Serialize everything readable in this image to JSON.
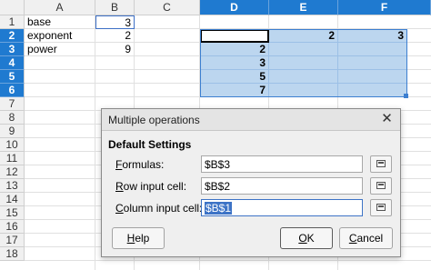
{
  "columns": [
    "A",
    "B",
    "C",
    "D",
    "E",
    "F"
  ],
  "rows": [
    "1",
    "2",
    "3",
    "4",
    "5",
    "6",
    "7",
    "8",
    "9",
    "10",
    "11",
    "12",
    "13",
    "14",
    "15",
    "16",
    "17",
    "18"
  ],
  "cells": {
    "a1": "base",
    "b1": "3",
    "a2": "exponent",
    "b2": "2",
    "a3": "power",
    "b3": "9",
    "e2": "2",
    "f2": "3",
    "d3": "2",
    "d4": "3",
    "d5": "5",
    "d6": "7"
  },
  "colors": {
    "selection_header": "#1f7ad0",
    "selection_fill": "#bcd6ef"
  },
  "dialog": {
    "title": "Multiple operations",
    "close_icon": "close-icon",
    "section": "Default Settings",
    "formulas_label_access": "F",
    "formulas_label_rest": "ormulas:",
    "formulas_value": "$B$3",
    "row_label_access": "R",
    "row_label_rest": "ow input cell:",
    "row_value": "$B$2",
    "col_label_access": "C",
    "col_label_rest": "olumn input cell:",
    "col_value": "$B$1",
    "help_access": "H",
    "help_rest": "elp",
    "ok_access": "O",
    "ok_rest": "K",
    "cancel_access": "C",
    "cancel_rest": "ancel"
  }
}
